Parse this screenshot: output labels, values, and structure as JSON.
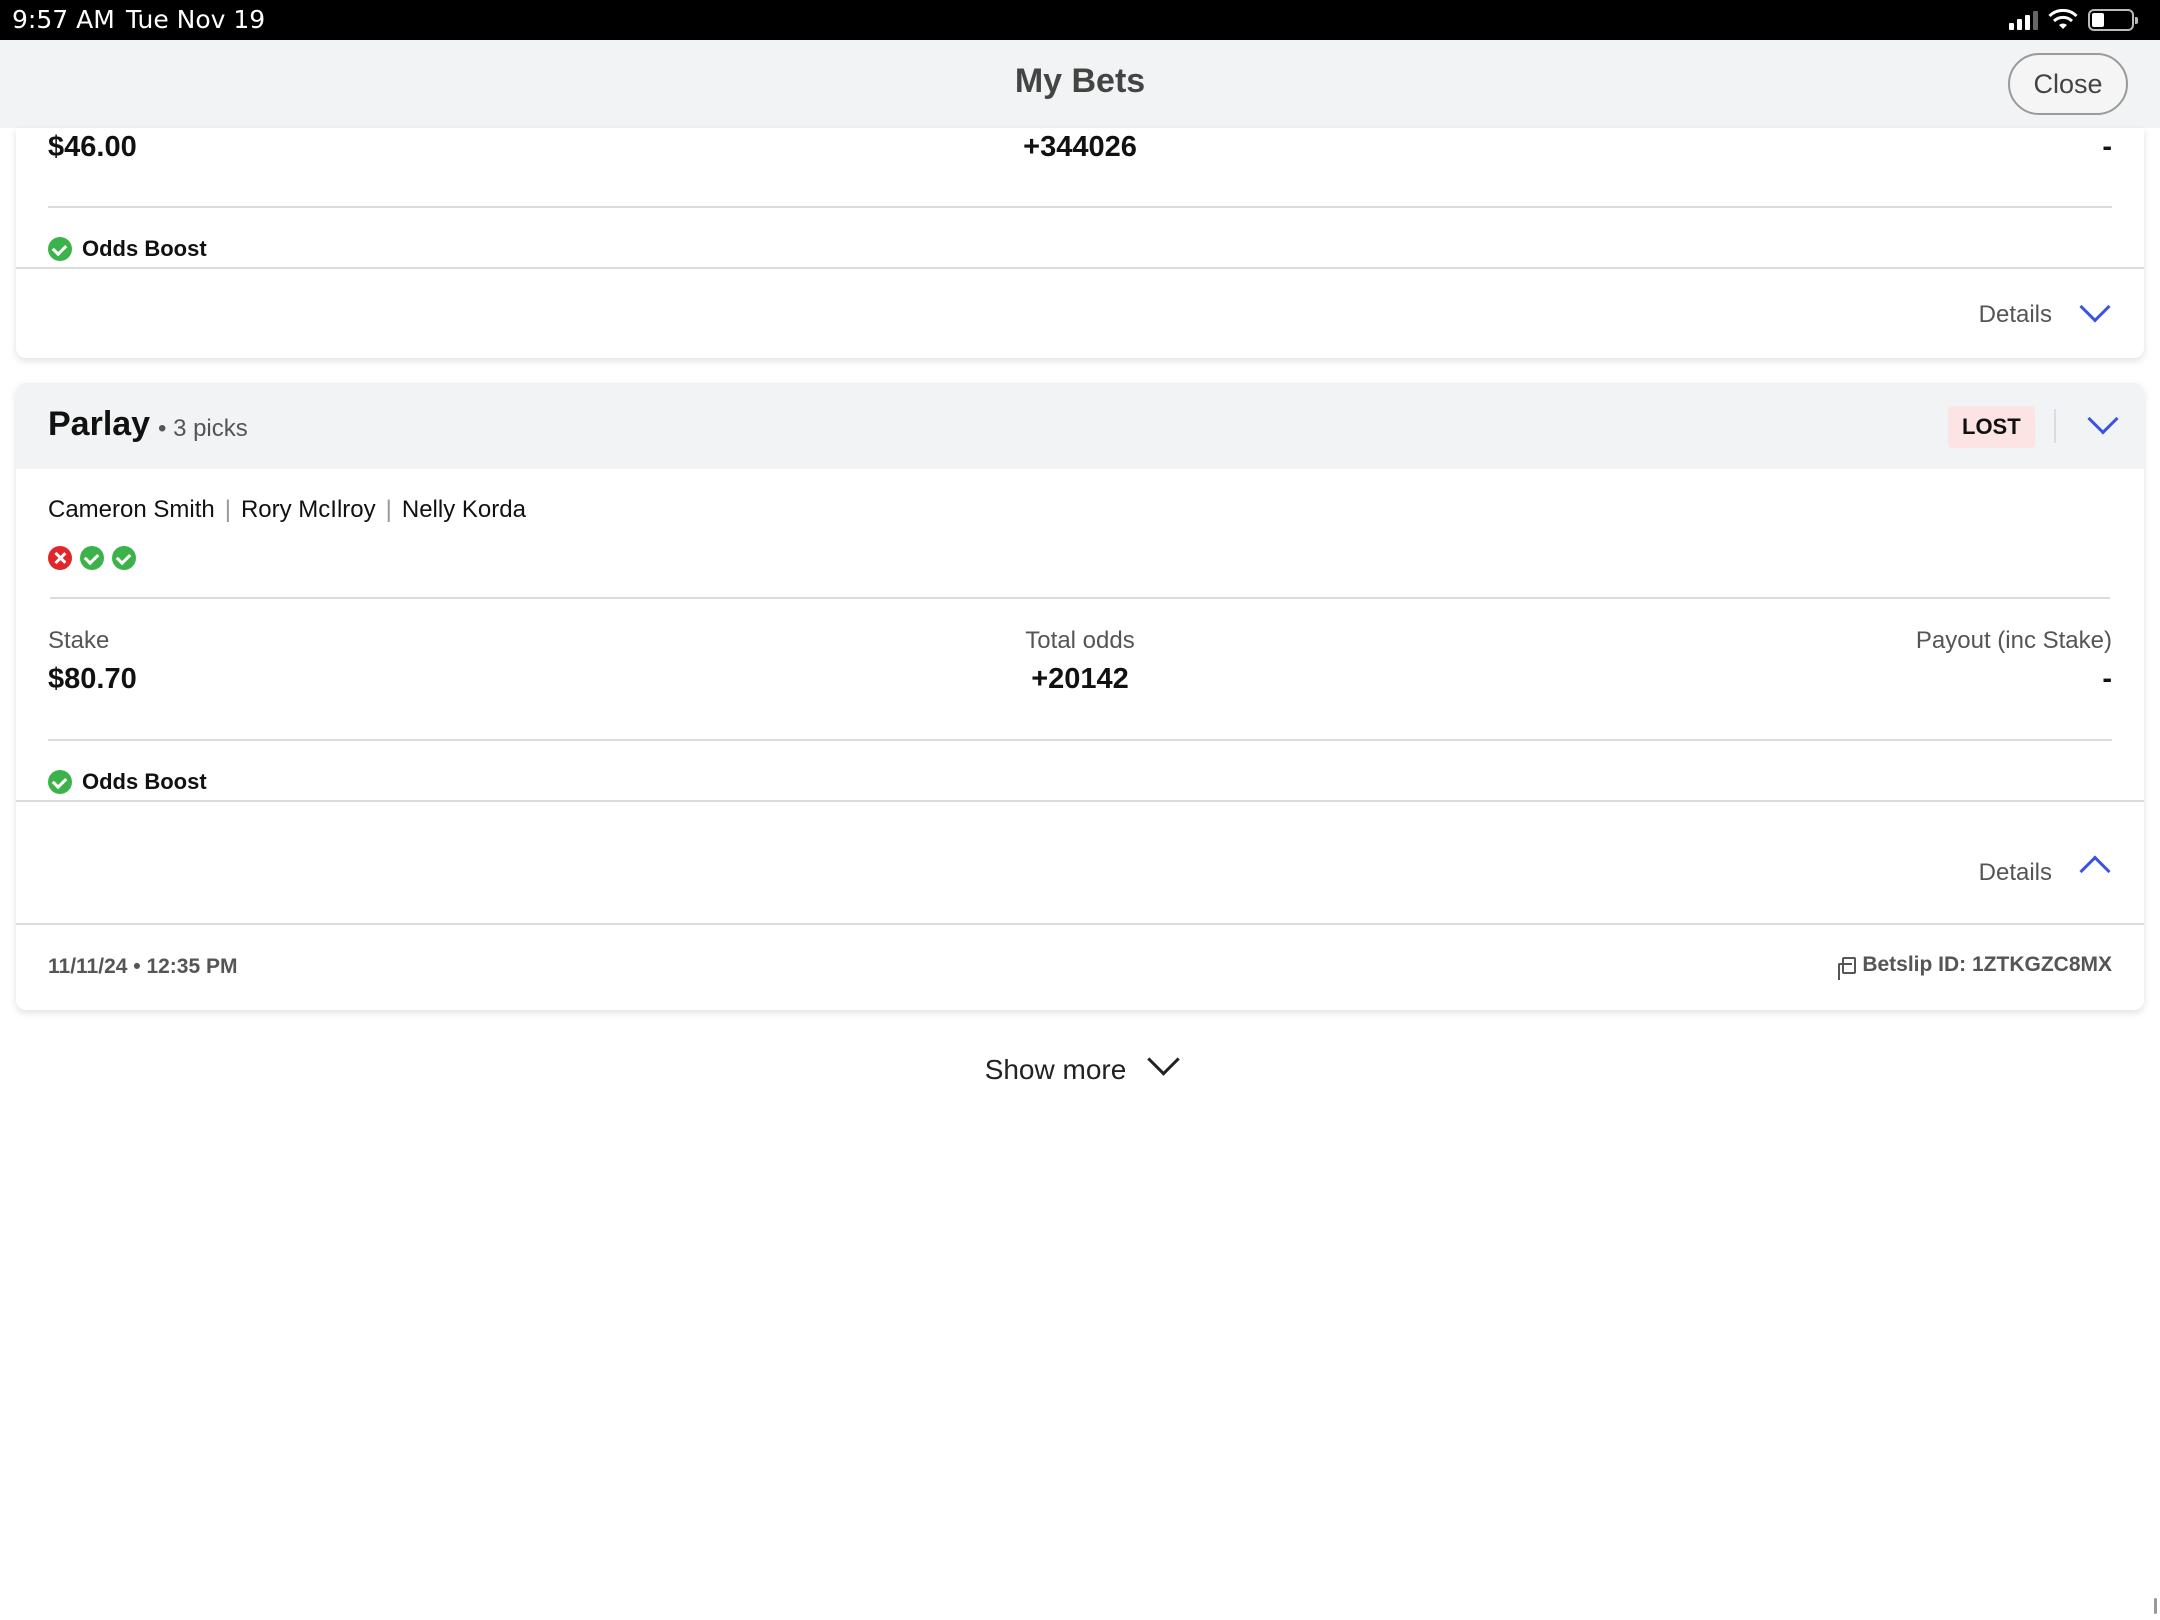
{
  "status_bar": {
    "time": "9:57 AM",
    "date": "Tue Nov 19"
  },
  "header": {
    "title": "My Bets",
    "close_label": "Close"
  },
  "bet1": {
    "stake": "$46.00",
    "total_odds": "+344026",
    "payout": "-",
    "boost_label": "Odds Boost",
    "details_label": "Details"
  },
  "bet2": {
    "type": "Parlay",
    "picks_count": "• 3 picks",
    "status": "LOST",
    "picks": [
      "Cameron Smith",
      "Rory McIlroy",
      "Nelly Korda"
    ],
    "pick_results": [
      "lost",
      "won",
      "won"
    ],
    "stake_label": "Stake",
    "stake": "$80.70",
    "total_odds_label": "Total odds",
    "total_odds": "+20142",
    "payout_label": "Payout (inc Stake)",
    "payout": "-",
    "boost_label": "Odds Boost",
    "details_label": "Details",
    "placed_at": "11/11/24 • 12:35 PM",
    "betslip_id": "Betslip ID: 1ZTKGZC8MX"
  },
  "show_more_label": "Show more",
  "colors": {
    "accent": "#3b54e0",
    "win": "#3cb34a",
    "loss": "#e0262b",
    "lost_badge_bg": "#fde4e4"
  }
}
